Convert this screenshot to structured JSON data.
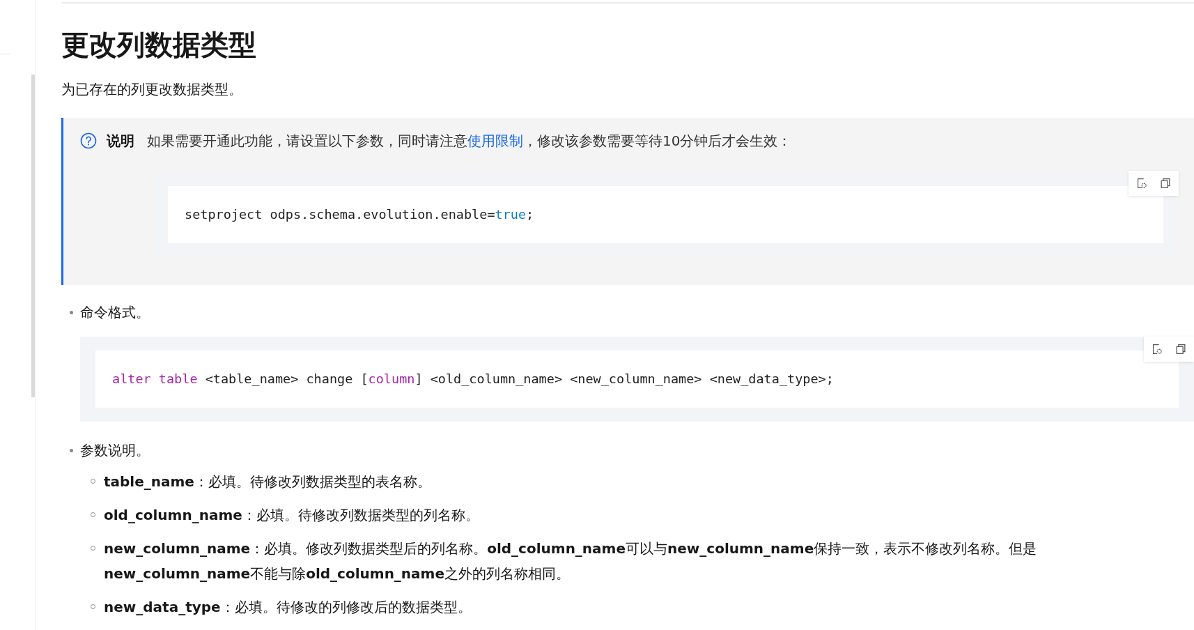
{
  "heading": "更改列数据类型",
  "intro": "为已存在的列更改数据类型。",
  "note": {
    "label": "说明",
    "text_before": "如果需要开通此功能，请设置以下参数，同时请注意",
    "link": "使用限制",
    "text_after": "，修改该参数需要等待10分钟后才会生效：",
    "code": [
      {
        "text": "setproject odps.schema.evolution.enable=",
        "kind": "plain"
      },
      {
        "text": "true",
        "kind": "literal"
      },
      {
        "text": ";",
        "kind": "plain"
      }
    ]
  },
  "list": [
    {
      "text": "命令格式。",
      "code": [
        {
          "text": "alter table",
          "kind": "keyword"
        },
        {
          "text": " <table_name> change [",
          "kind": "plain"
        },
        {
          "text": "column",
          "kind": "keyword"
        },
        {
          "text": "] <old_column_name> <new_column_name> <new_data_type>;",
          "kind": "plain"
        }
      ]
    },
    {
      "text": "参数说明。",
      "items": [
        {
          "text": "**table_name**：必填。待修改列数据类型的表名称。"
        },
        {
          "text": "**old_column_name**：必填。待修改列数据类型的列名称。"
        },
        {
          "text": "**new_column_name**：必填。修改列数据类型后的列名称。**old_column_name**可以与**new_column_name**保持一致，表示不修改列名称。但是**new_column_name**不能与除**old_column_name**之外的列名称相同。"
        },
        {
          "text": "**new_data_type**：必填。待修改的列修改后的数据类型。"
        }
      ]
    }
  ]
}
